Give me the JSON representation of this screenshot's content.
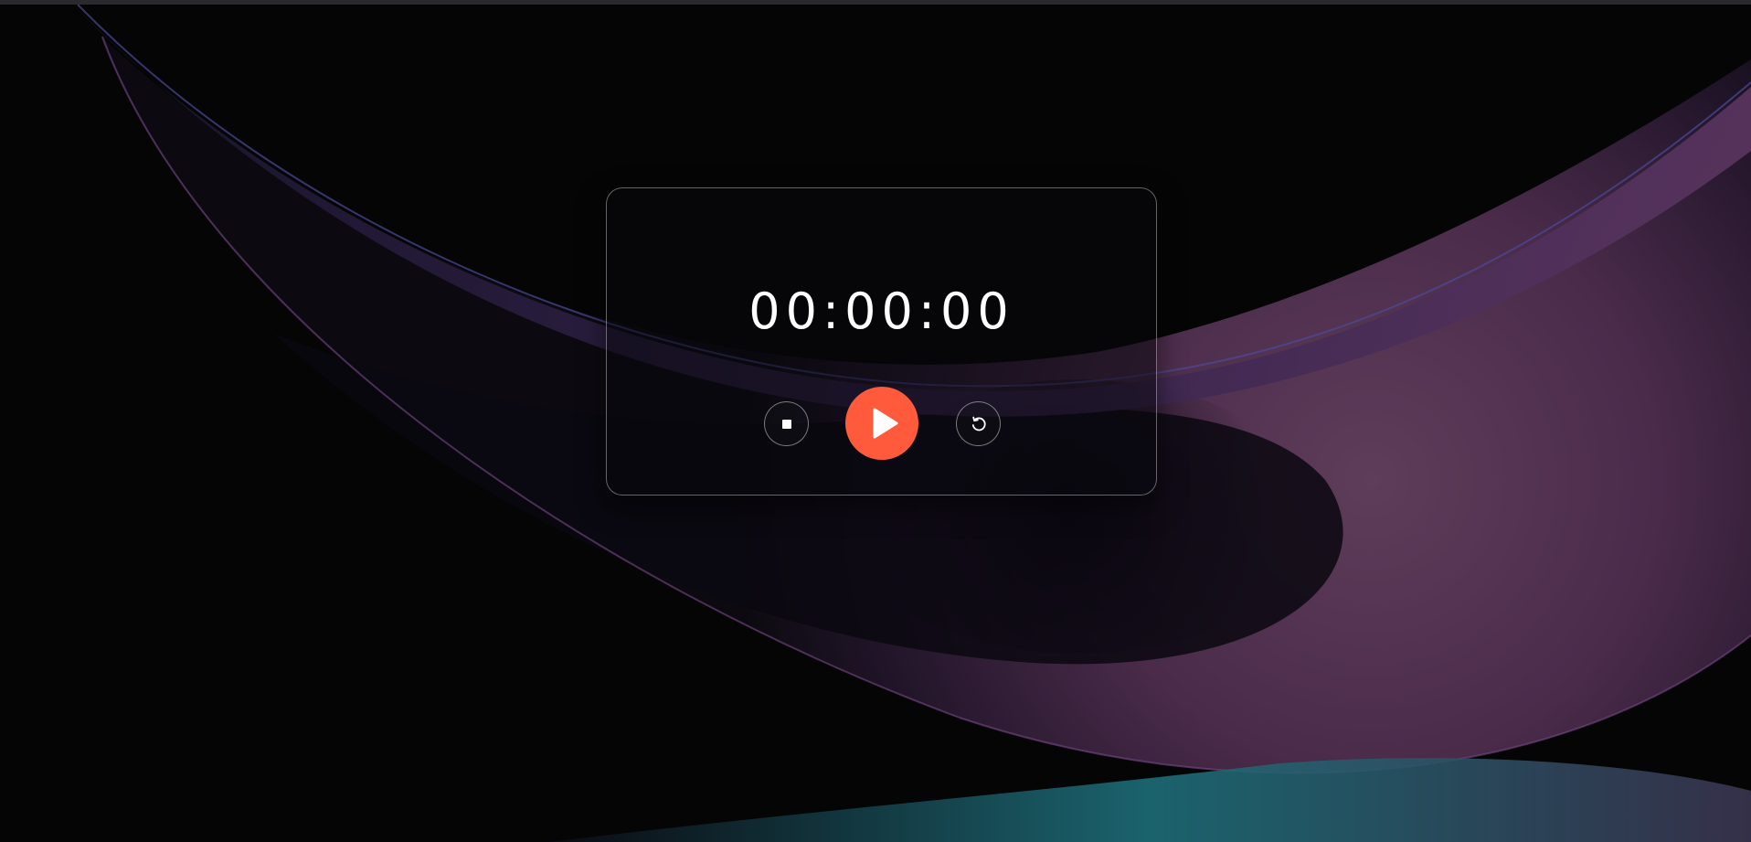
{
  "timer": {
    "display": "00:00:00"
  },
  "controls": {
    "stop_icon": "stop-icon",
    "play_icon": "play-icon",
    "reset_icon": "reset-icon"
  },
  "colors": {
    "accent": "#ff5a3c",
    "background": "#050506"
  }
}
